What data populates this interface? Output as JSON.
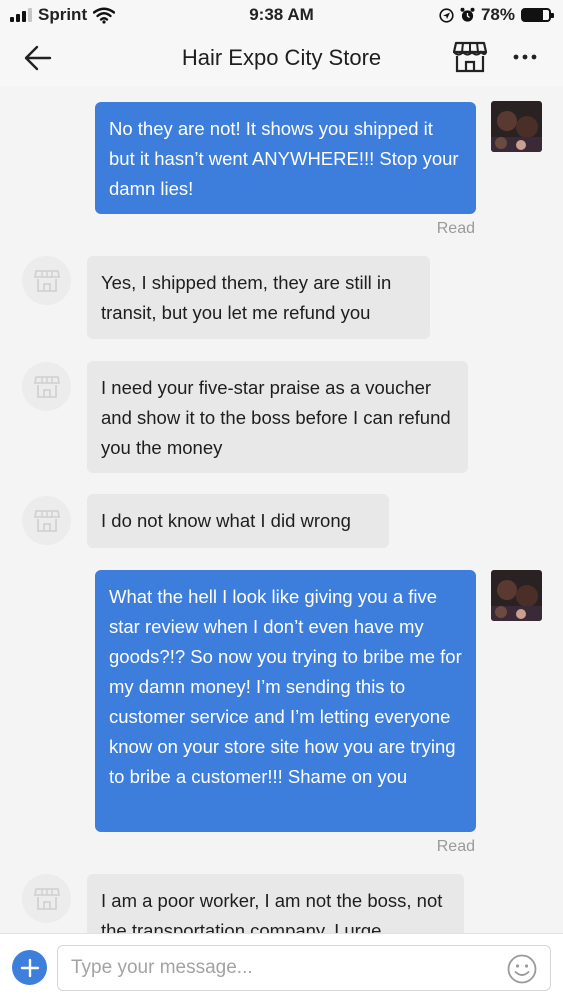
{
  "status_bar": {
    "carrier": "Sprint",
    "time": "9:38 AM",
    "battery": "78%",
    "battery_level": 0.78,
    "icons": [
      "signal-icon",
      "wifi-icon",
      "location-icon",
      "alarm-icon",
      "battery-icon"
    ]
  },
  "header": {
    "title": "Hair Expo City Store",
    "icons": [
      "back-arrow-icon",
      "store-icon",
      "more-icon"
    ]
  },
  "messages": [
    {
      "sender": "me",
      "text": "No they are not! It shows you shipped it but it hasn’t went ANYWHERE!!! Stop your damn lies!",
      "status": "Read"
    },
    {
      "sender": "store",
      "text": "Yes, I shipped them, they are still in transit, but you let me refund you"
    },
    {
      "sender": "store",
      "text": "I need your five-star praise as a voucher and show it to the boss before I can refund you the money"
    },
    {
      "sender": "store",
      "text": "I do not know what I did wrong"
    },
    {
      "sender": "me",
      "text": "What the hell I look like giving you a five star review when I don’t even have my goods?!? So now you trying to bribe me for my damn money! I’m sending this to customer service and I’m letting everyone know on your store site how you are trying to bribe a customer!!! Shame on you",
      "status": "Read"
    },
    {
      "sender": "store",
      "text": "I am a poor worker, I am not the boss, not the transportation company. I urge"
    }
  ],
  "composer": {
    "placeholder": "Type your message...",
    "icons": [
      "add-icon",
      "emoji-icon"
    ]
  },
  "colors": {
    "outgoing_bubble": "#3d7edc",
    "incoming_bubble": "#e8e8e8",
    "accent": "#3f7fdc"
  }
}
